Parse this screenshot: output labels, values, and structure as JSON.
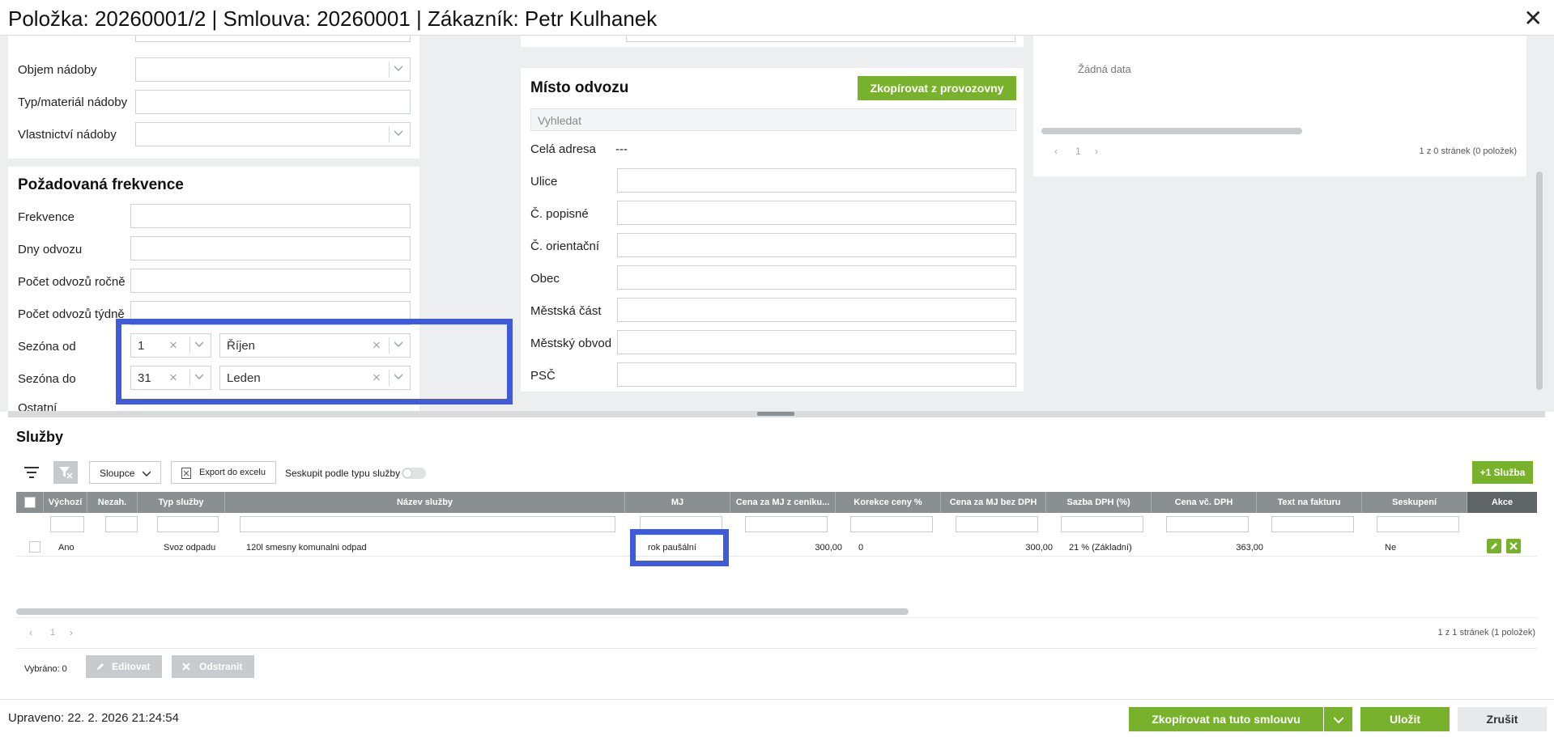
{
  "window": {
    "title": "Položka: 20260001/2 | Smlouva: 20260001 | Zákazník: Petr Kulhanek",
    "close_glyph": "✕"
  },
  "container_section": {
    "rows": [
      {
        "label": "Objem nádoby",
        "value": ""
      },
      {
        "label": "Typ/materiál nádoby",
        "value": ""
      },
      {
        "label": "Vlastnictví nádoby",
        "value": ""
      }
    ]
  },
  "frequency": {
    "title": "Požadovaná frekvence",
    "rows": [
      {
        "label": "Frekvence",
        "value": ""
      },
      {
        "label": "Dny odvozu",
        "value": ""
      },
      {
        "label": "Počet odvozů ročně",
        "value": ""
      },
      {
        "label": "Počet odvozů týdně",
        "value": ""
      }
    ],
    "season_from": {
      "label": "Sezóna od",
      "day": "1",
      "month": "Říjen"
    },
    "season_to": {
      "label": "Sezóna do",
      "day": "31",
      "month": "Leden"
    },
    "other_label": "Ostatní"
  },
  "pickup": {
    "title": "Místo odvozu",
    "copy_button": "Zkopírovat z provozovny",
    "search_placeholder": "Vyhledat",
    "full_address_label": "Celá adresa",
    "full_address_value": "---",
    "rows": [
      {
        "label": "Ulice",
        "value": ""
      },
      {
        "label": "Č. popisné",
        "value": ""
      },
      {
        "label": "Č. orientační",
        "value": ""
      },
      {
        "label": "Obec",
        "value": ""
      },
      {
        "label": "Městská část",
        "value": ""
      },
      {
        "label": "Městský obvod",
        "value": ""
      },
      {
        "label": "PSČ",
        "value": ""
      }
    ]
  },
  "right_panel": {
    "empty_text": "Žádná data",
    "page_number": "1",
    "pager_text": "1 z 0 stránek (0 položek)"
  },
  "services": {
    "title": "Služby",
    "columns_button": "Sloupce",
    "export_button": "Export do excelu",
    "group_label": "Seskupit podle typu služby",
    "add_button": "+1 Služba",
    "headers": [
      "Výchozí",
      "Nezah.",
      "Typ služby",
      "Název služby",
      "MJ",
      "Cena za MJ z ceníku...",
      "Korekce ceny %",
      "Cena za MJ bez DPH",
      "Sazba DPH (%)",
      "Cena vč. DPH",
      "Text na fakturu",
      "Seskupení",
      "Akce"
    ],
    "rows": [
      {
        "default": "Ano",
        "excluded": "",
        "type": "Svoz odpadu",
        "name": "120l smesny komunalni odpad",
        "unit": "rok paušální",
        "price_list": "300,00",
        "correction": "0",
        "price_no_vat": "300,00",
        "vat_rate": "21 % (Základní)",
        "price_vat": "363,00",
        "invoice_text": "",
        "grouping": "Ne"
      }
    ],
    "page_number": "1",
    "pager_text": "1 z 1 stránek (1 položek)",
    "selected_text": "Vybráno: 0",
    "edit_button": "Editovat",
    "remove_button": "Odstranit"
  },
  "footer": {
    "modified_text": "Upraveno: 22. 2. 2026 21:24:54",
    "copy_to_contract": "Zkopírovat na tuto smlouvu",
    "save": "Uložit",
    "cancel": "Zrušit"
  },
  "colors": {
    "accent_green": "#78b22d",
    "highlight_blue": "#3f5bd8",
    "grid_header": "#8a8f91"
  },
  "icons": [
    "close-icon",
    "chevron-down-icon",
    "clear-icon",
    "filter-icon",
    "filter-clear-icon",
    "excel-icon",
    "pencil-icon",
    "delete-icon",
    "chevron-left-icon",
    "chevron-right-icon"
  ]
}
